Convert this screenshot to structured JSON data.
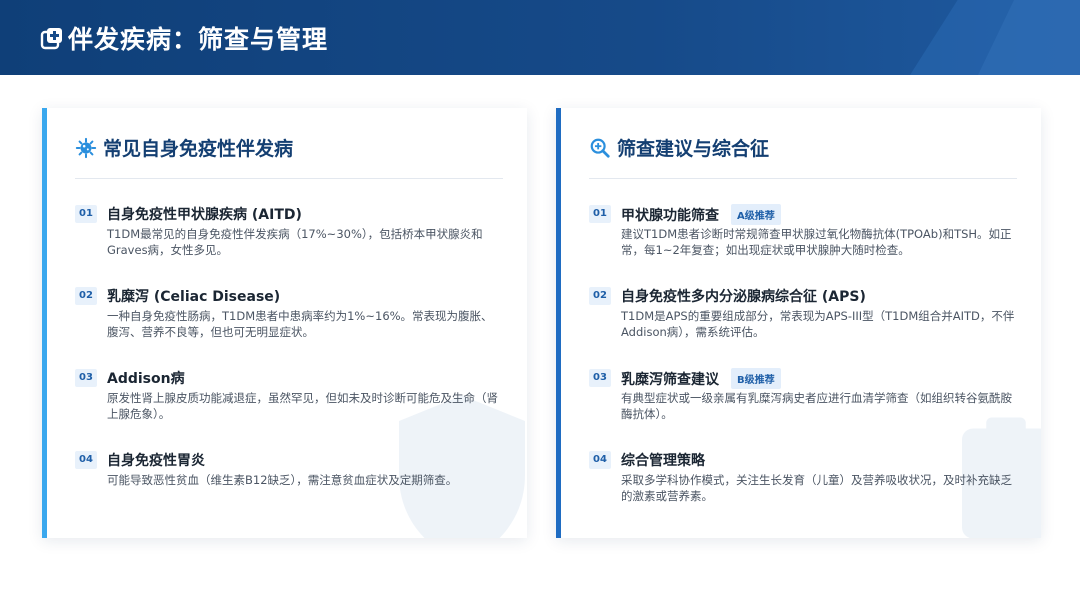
{
  "header": {
    "title": "伴发疾病：筛查与管理",
    "icon": "medical-cross-icon",
    "background": "#164a89"
  },
  "left_card": {
    "title": "常见自身免疫性伴发病",
    "icon": "virus-icon",
    "accent": "#3aa8ee",
    "items": [
      {
        "num": "01",
        "title": "自身免疫性甲状腺疾病 (AITD)",
        "desc": "T1DM最常见的自身免疫性伴发疾病（17%~30%），包括桥本甲状腺炎和Graves病，女性多见。"
      },
      {
        "num": "02",
        "title": "乳糜泻 (Celiac Disease)",
        "desc": "一种自身免疫性肠病，T1DM患者中患病率约为1%~16%。常表现为腹胀、腹泻、营养不良等，但也可无明显症状。"
      },
      {
        "num": "03",
        "title": "Addison病",
        "desc": "原发性肾上腺皮质功能减退症，虽然罕见，但如未及时诊断可能危及生命（肾上腺危象）。"
      },
      {
        "num": "04",
        "title": "自身免疫性胃炎",
        "desc": "可能导致恶性贫血（维生素B12缺乏），需注意贫血症状及定期筛查。"
      }
    ]
  },
  "right_card": {
    "title": "筛查建议与综合征",
    "icon": "search-plus-icon",
    "accent": "#1f6cc2",
    "items": [
      {
        "num": "01",
        "title": "甲状腺功能筛查",
        "badge": "A级推荐",
        "desc": "建议T1DM患者诊断时常规筛查甲状腺过氧化物酶抗体(TPOAb)和TSH。如正常，每1~2年复查；如出现症状或甲状腺肿大随时检查。"
      },
      {
        "num": "02",
        "title": "自身免疫性多内分泌腺病综合征 (APS)",
        "desc": "T1DM是APS的重要组成部分，常表现为APS-III型（T1DM组合并AITD，不伴Addison病），需系统评估。"
      },
      {
        "num": "03",
        "title": "乳糜泻筛查建议",
        "badge": "B级推荐",
        "desc": "有典型症状或一级亲属有乳糜泻病史者应进行血清学筛查（如组织转谷氨酰胺酶抗体）。"
      },
      {
        "num": "04",
        "title": "综合管理策略",
        "desc": "采取多学科协作模式，关注生长发育（儿童）及营养吸收状况，及时补充缺乏的激素或营养素。"
      }
    ]
  }
}
